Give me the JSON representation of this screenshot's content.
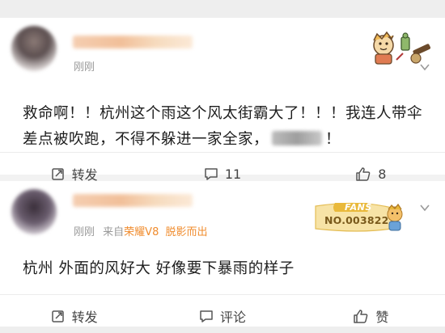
{
  "posts": [
    {
      "time": "刚刚",
      "text_before_blur": "救命啊！！杭州这个雨这个风太街霸大了！！！我连人带伞差点被吹跑，不得不躲进一家全家，",
      "text_after_blur": "！",
      "actions": {
        "repost_label": "转发",
        "comment_count": "11",
        "like_count": "8"
      }
    },
    {
      "time": "刚刚",
      "source_prefix": "来自",
      "device": "荣耀V8",
      "source_suffix": "脱影而出",
      "text": "杭州  外面的风好大  好像要下暴雨的样子",
      "fans_badge": {
        "label": "FANS",
        "number": "NO.003822"
      },
      "actions": {
        "repost_label": "转发",
        "comment_label": "评论",
        "like_label": "赞"
      }
    }
  ],
  "colors": {
    "accent": "#f08c2e",
    "meta": "#9a9a9a",
    "background": "#f2f2f2"
  },
  "icons": [
    "repost-icon",
    "comment-icon",
    "like-icon",
    "chevron-down-icon",
    "sticker-icon",
    "fans-badge-icon"
  ]
}
